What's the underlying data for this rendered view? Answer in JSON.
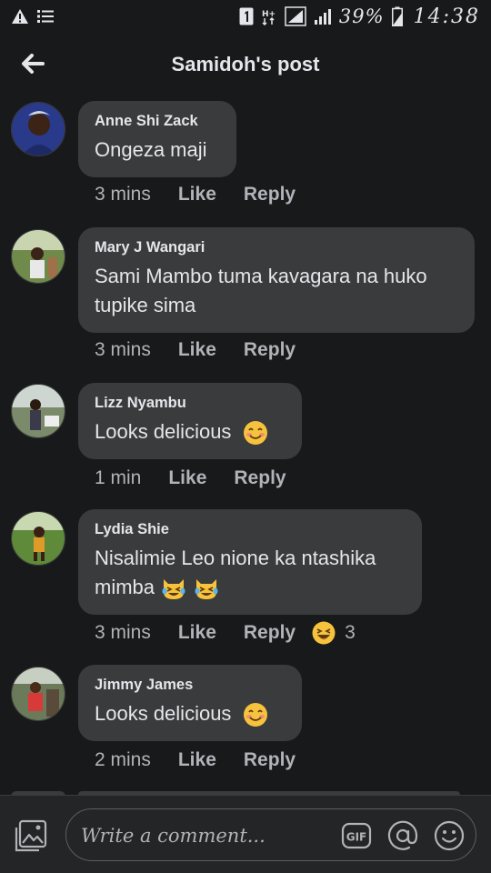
{
  "status_bar": {
    "battery_percent": "39%",
    "time": "14:38",
    "icons": [
      "warning-icon",
      "list-icon",
      "notification-1-icon",
      "hplus-icon",
      "signal-icon",
      "battery-icon"
    ]
  },
  "header": {
    "title": "Samidoh's post",
    "back_icon": "back-arrow-icon"
  },
  "comments": [
    {
      "author": "Anne Shi Zack",
      "text": "Ongeza maji",
      "time": "3 mins",
      "like": "Like",
      "reply": "Reply"
    },
    {
      "author": "Mary J Wangari",
      "text": "Sami Mambo tuma kavagara na huko tupike sima",
      "time": "3 mins",
      "like": "Like",
      "reply": "Reply"
    },
    {
      "author": "Lizz Nyambu",
      "text": "Looks delicious",
      "emoji": "smiling-face-emoji",
      "time": "1 min",
      "like": "Like",
      "reply": "Reply"
    },
    {
      "author": "Lydia Shie",
      "text": "Nisalimie Leo nione ka ntashika mimba",
      "emoji": "crying-laughing-cat-emoji",
      "time": "3 mins",
      "like": "Like",
      "reply": "Reply",
      "reaction_icon": "haha-reaction-icon",
      "reaction_count": "3"
    },
    {
      "author": "Jimmy James",
      "text": "Looks delicious",
      "emoji": "smiling-face-emoji",
      "time": "2 mins",
      "like": "Like",
      "reply": "Reply"
    }
  ],
  "composer": {
    "placeholder": "Write a comment...",
    "gif_label": "GIF",
    "icons": [
      "photo-icon",
      "gif-icon",
      "mention-icon",
      "emoji-icon"
    ]
  },
  "colors": {
    "background": "#18191a",
    "bubble": "#3a3b3c",
    "text": "#e4e6eb",
    "secondary_text": "#b0b3b8",
    "composer_background": "#242526"
  }
}
